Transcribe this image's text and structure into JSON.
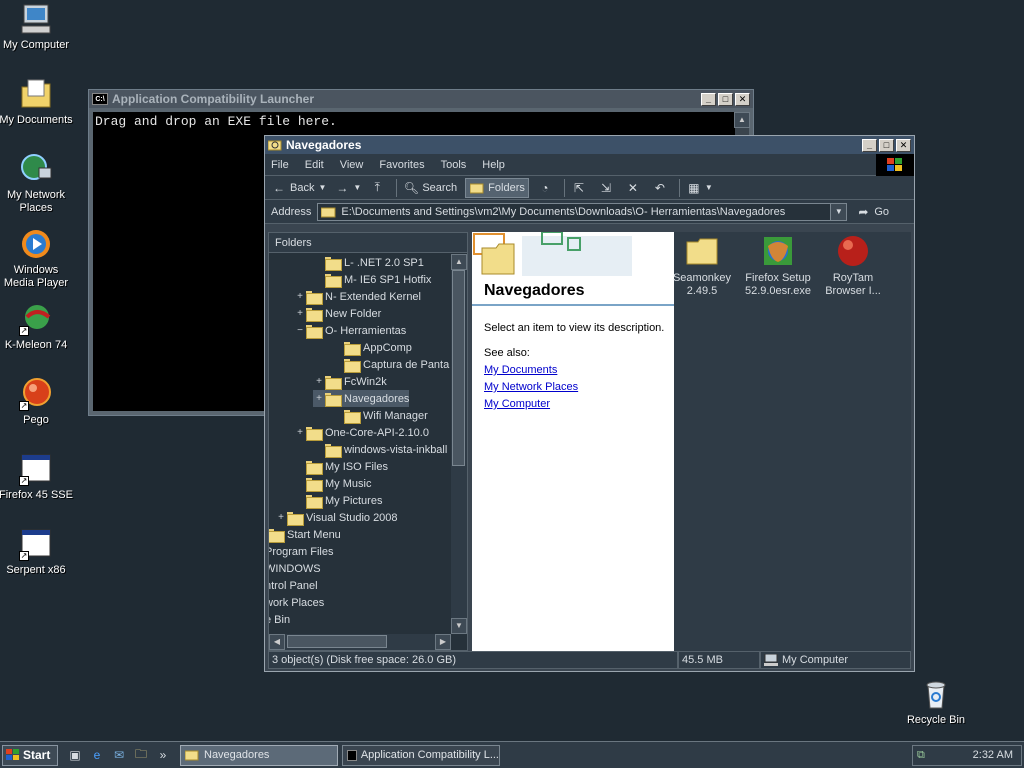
{
  "desktop": {
    "icons": [
      {
        "label": "My Computer",
        "icon": "my-computer-icon"
      },
      {
        "label": "My Documents",
        "icon": "my-documents-icon"
      },
      {
        "label": "My Network Places",
        "icon": "network-places-icon"
      },
      {
        "label": "Windows Media Player",
        "icon": "media-player-icon"
      },
      {
        "label": "K-Meleon 74",
        "icon": "k-meleon-icon"
      },
      {
        "label": "Pego",
        "icon": "pego-icon"
      },
      {
        "label": "Firefox 45 SSE",
        "icon": "app-window-icon"
      },
      {
        "label": "Serpent x86",
        "icon": "app-window-icon"
      },
      {
        "label": "Recycle Bin",
        "icon": "recycle-bin-icon"
      }
    ]
  },
  "console": {
    "title": "Application Compatibility Launcher",
    "icon_text": "C:\\",
    "text": "Drag and drop an EXE file here."
  },
  "explorer": {
    "title": "Navegadores",
    "menu": [
      "File",
      "Edit",
      "View",
      "Favorites",
      "Tools",
      "Help"
    ],
    "toolbar": {
      "back": "Back",
      "search": "Search",
      "folders": "Folders"
    },
    "address_label": "Address",
    "address": "E:\\Documents and Settings\\vm2\\My Documents\\Downloads\\O- Herramientas\\Navegadores",
    "go": "Go",
    "folders_header": "Folders",
    "tree": [
      {
        "label": "L- .NET 2.0 SP1",
        "expander": ""
      },
      {
        "label": "M- IE6 SP1 Hotfix",
        "expander": ""
      },
      {
        "label": "N- Extended Kernel",
        "expander": "+"
      },
      {
        "label": "New Folder",
        "expander": "+"
      },
      {
        "label": "O- Herramientas",
        "expander": "−"
      },
      {
        "label": "AppComp",
        "expander": ""
      },
      {
        "label": "Captura de Panta",
        "expander": ""
      },
      {
        "label": "FcWin2k",
        "expander": "+"
      },
      {
        "label": "Navegadores",
        "expander": "+"
      },
      {
        "label": "Wifi Manager",
        "expander": ""
      },
      {
        "label": "One-Core-API-2.10.0",
        "expander": "+"
      },
      {
        "label": "windows-vista-inkball",
        "expander": ""
      },
      {
        "label": "My ISO Files",
        "expander": ""
      },
      {
        "label": "My Music",
        "expander": ""
      },
      {
        "label": "My Pictures",
        "expander": ""
      },
      {
        "label": "Visual Studio 2008",
        "expander": "+"
      },
      {
        "label": "Start Menu",
        "expander": "+"
      },
      {
        "label": "Program Files",
        "expander": ""
      },
      {
        "label": "WINDOWS",
        "expander": ""
      },
      {
        "label": "ntrol Panel",
        "expander": ""
      },
      {
        "label": "work Places",
        "expander": ""
      },
      {
        "label": "e Bin",
        "expander": ""
      }
    ],
    "info": {
      "title": "Navegadores",
      "description": "Select an item to view its description.",
      "see_also": "See also:",
      "links": [
        "My Documents",
        "My Network Places",
        "My Computer"
      ]
    },
    "files": [
      {
        "name": "Seamonkey 2.49.5",
        "line1": "Seamonkey",
        "line2": "2.49.5",
        "icon": "folder-icon"
      },
      {
        "name": "Firefox Setup 52.9.0esr.exe",
        "line1": "Firefox Setup",
        "line2": "52.9.0esr.exe",
        "icon": "firefox-icon"
      },
      {
        "name": "RoyTam Browser I...",
        "line1": "RoyTam",
        "line2": "Browser I...",
        "icon": "roytam-icon"
      }
    ],
    "status": {
      "objects": "3 object(s) (Disk free space: 26.0 GB)",
      "size": "45.5 MB",
      "zone": "My Computer"
    }
  },
  "taskbar": {
    "start": "Start",
    "buttons": [
      "Navegadores",
      "Application Compatibility L..."
    ],
    "quick_launch_more": "»",
    "clock": "2:32 AM"
  }
}
